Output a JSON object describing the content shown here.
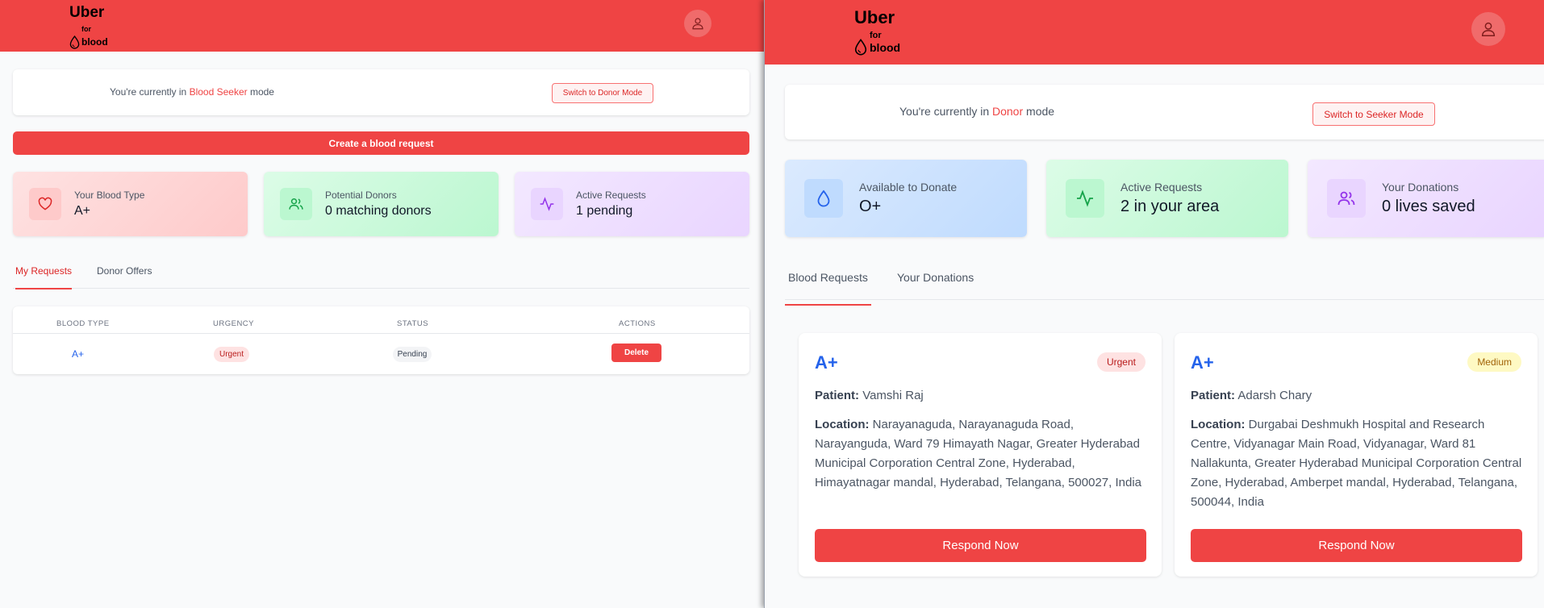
{
  "brand": {
    "name": "Uber",
    "for": "for",
    "blood": "blood"
  },
  "seeker": {
    "mode_prefix": "You're currently in ",
    "mode_name": "Blood Seeker",
    "mode_suffix": " mode",
    "switch_label": "Switch to Donor Mode",
    "create_label": "Create a blood request",
    "stats": [
      {
        "label": "Your Blood Type",
        "value": "A+",
        "icon": "heart-icon",
        "color": "red"
      },
      {
        "label": "Potential Donors",
        "value": "0 matching donors",
        "icon": "users-icon",
        "color": "green"
      },
      {
        "label": "Active Requests",
        "value": "1 pending",
        "icon": "activity-icon",
        "color": "purple"
      }
    ],
    "tabs": [
      {
        "label": "My Requests",
        "active": true
      },
      {
        "label": "Donor Offers",
        "active": false
      }
    ],
    "table": {
      "headers": [
        "BLOOD TYPE",
        "URGENCY",
        "STATUS",
        "ACTIONS"
      ],
      "rows": [
        {
          "blood_type": "A+",
          "urgency": "Urgent",
          "status": "Pending",
          "action": "Delete"
        }
      ]
    }
  },
  "donor": {
    "mode_prefix": "You're currently in ",
    "mode_name": "Donor",
    "mode_suffix": " mode",
    "switch_label": "Switch to Seeker Mode",
    "stats": [
      {
        "label": "Available to Donate",
        "value": "O+",
        "icon": "droplet-icon",
        "color": "blue"
      },
      {
        "label": "Active Requests",
        "value": "2 in your area",
        "icon": "activity-icon",
        "color": "green"
      },
      {
        "label": "Your Donations",
        "value": "0 lives saved",
        "icon": "users-icon",
        "color": "purple"
      }
    ],
    "tabs": [
      {
        "label": "Blood Requests",
        "active": true
      },
      {
        "label": "Your Donations",
        "active": false
      }
    ],
    "requests": [
      {
        "blood_type": "A+",
        "urgency": "Urgent",
        "patient_label": "Patient:",
        "patient": "Vamshi Raj",
        "location_label": "Location:",
        "location": "Narayanaguda, Narayanaguda Road, Narayanguda, Ward 79 Himayath Nagar, Greater Hyderabad Municipal Corporation Central Zone, Hyderabad, Himayatnagar mandal, Hyderabad, Telangana, 500027, India",
        "button": "Respond Now"
      },
      {
        "blood_type": "A+",
        "urgency": "Medium",
        "patient_label": "Patient:",
        "patient": "Adarsh Chary",
        "location_label": "Location:",
        "location": "Durgabai Deshmukh Hospital and Research Centre, Vidyanagar Main Road, Vidyanagar, Ward 81 Nallakunta, Greater Hyderabad Municipal Corporation Central Zone, Hyderabad, Amberpet mandal, Hyderabad, Telangana, 500044, India",
        "button": "Respond Now"
      }
    ]
  },
  "colors": {
    "brand": "#ef4444",
    "accent_text": "#dc2626",
    "blood_type_blue": "#2563eb"
  }
}
